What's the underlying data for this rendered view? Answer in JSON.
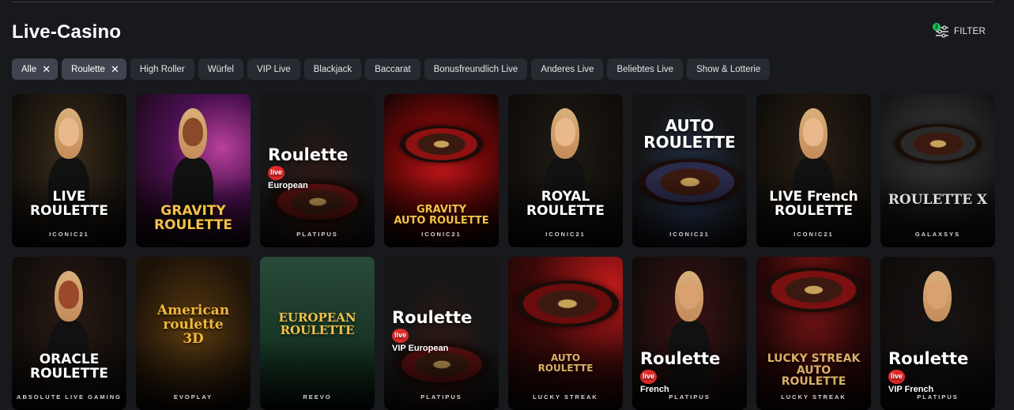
{
  "page": {
    "title": "Live-Casino"
  },
  "filter": {
    "label": "FILTER",
    "badge": "2"
  },
  "chips": [
    {
      "label": "Alle",
      "active": true,
      "closable": true
    },
    {
      "label": "Roulette",
      "active": true,
      "closable": true
    },
    {
      "label": "High Roller",
      "active": false,
      "closable": false
    },
    {
      "label": "Würfel",
      "active": false,
      "closable": false
    },
    {
      "label": "VIP Live",
      "active": false,
      "closable": false
    },
    {
      "label": "Blackjack",
      "active": false,
      "closable": false
    },
    {
      "label": "Baccarat",
      "active": false,
      "closable": false
    },
    {
      "label": "Bonusfreundlich Live",
      "active": false,
      "closable": false
    },
    {
      "label": "Anderes Live",
      "active": false,
      "closable": false
    },
    {
      "label": "Beliebtes Live",
      "active": false,
      "closable": false
    },
    {
      "label": "Show & Lotterie",
      "active": false,
      "closable": false
    }
  ],
  "games": [
    {
      "name": "LIVE\nROULETTE",
      "provider": "ICONIC21",
      "style": "dealer",
      "bg": "#3a2c1a",
      "accent": "#e9b98b"
    },
    {
      "name": "GRAVITY\nROULETTE",
      "provider": "",
      "style": "gravity",
      "bg": "#2a1230",
      "accent": "#f3c146"
    },
    {
      "name": "Roulette",
      "sub": "European",
      "provider": "PLATIPUS",
      "style": "platipus",
      "bg": "#161616",
      "accent": "#c4272a"
    },
    {
      "name": "GRAVITY\nAUTO ROULETTE",
      "provider": "ICONIC21",
      "style": "gravity-auto",
      "bg": "#3a0a0a",
      "accent": "#f3c146"
    },
    {
      "name": "ROYAL\nROULETTE",
      "provider": "ICONIC21",
      "style": "dealer",
      "bg": "#1f1a14",
      "accent": "#e9b98b"
    },
    {
      "name": "AUTO\nROULETTE",
      "provider": "ICONIC21",
      "style": "auto",
      "bg": "#1c1a18",
      "accent": "#e8b24a"
    },
    {
      "name": "LIVE French\nROULETTE",
      "provider": "ICONIC21",
      "style": "dealer",
      "bg": "#2a1f14",
      "accent": "#e9b98b"
    },
    {
      "name": "ROULETTE X",
      "provider": "GALAXSYS",
      "style": "rx",
      "bg": "#141414",
      "accent": "#cfcfcf"
    },
    {
      "name": "ORACLE\nROULETTE",
      "provider": "ABSOLUTE LIVE GAMING",
      "style": "oracle",
      "bg": "#2a1a14",
      "accent": "#e2b45a"
    },
    {
      "name": "American\nroulette\n3D",
      "provider": "EVOPLAY",
      "style": "american",
      "bg": "#2a1c0c",
      "accent": "#f0b83a"
    },
    {
      "name": "EUROPEAN\nROULETTE",
      "provider": "REEVO",
      "style": "european",
      "bg": "#1a3a2a",
      "accent": "#f2c24a"
    },
    {
      "name": "Roulette",
      "sub": "VIP European",
      "provider": "PLATIPUS",
      "style": "platipus",
      "bg": "#161616",
      "accent": "#c4272a"
    },
    {
      "name": "AUTO\nROULETTE",
      "provider": "LUCKY STREAK",
      "style": "lucky-auto",
      "bg": "#200a0a",
      "accent": "#d9b068"
    },
    {
      "name": "Roulette",
      "sub": "French",
      "provider": "PLATIPUS",
      "style": "platipus-dealer",
      "bg": "#3a1212",
      "accent": "#c4272a"
    },
    {
      "name": "LUCKY STREAK\nAUTO\nROULETTE",
      "provider": "LUCKY STREAK",
      "style": "lucky",
      "bg": "#2a0c0c",
      "accent": "#d9b068"
    },
    {
      "name": "Roulette",
      "sub": "VIP French",
      "provider": "PLATIPUS",
      "style": "platipus-dealer",
      "bg": "#1a1414",
      "accent": "#c4272a"
    }
  ]
}
